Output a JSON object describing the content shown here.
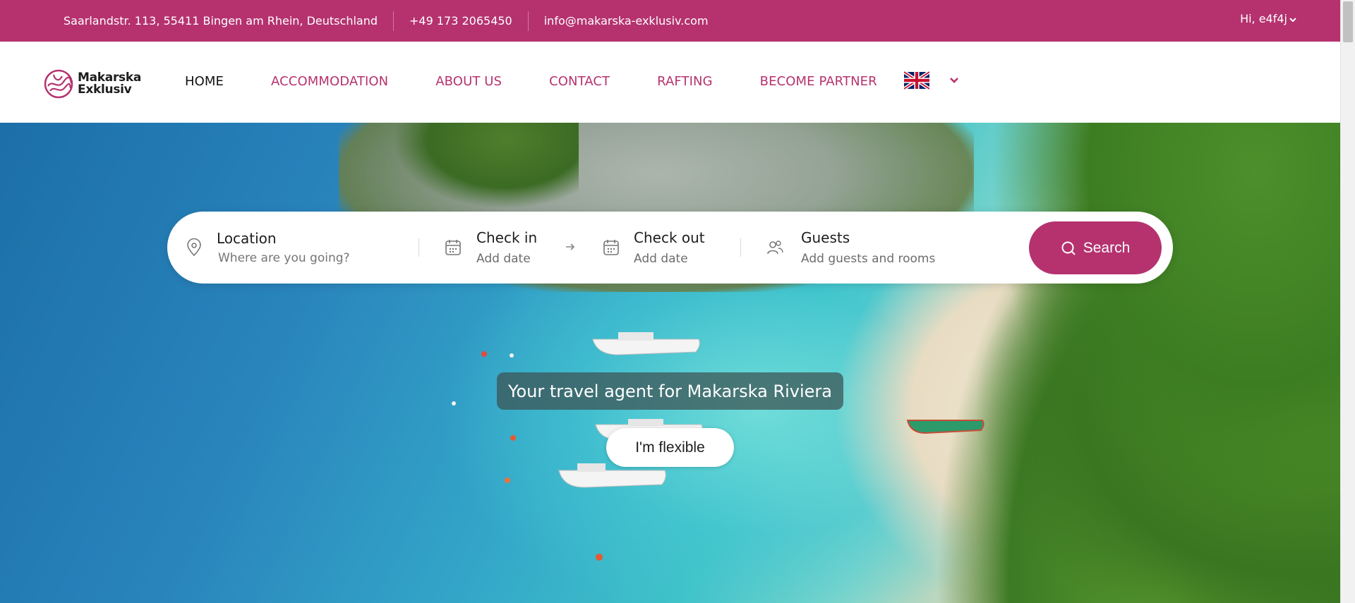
{
  "topbar": {
    "address": "Saarlandstr. 113, 55411 Bingen am Rhein, Deutschland",
    "phone": "+49 173 2065450",
    "email": "info@makarska-exklusiv.com",
    "user_greeting": "Hi, e4f4j"
  },
  "brand": {
    "line1": "Makarska",
    "line2": "Exklusiv",
    "color": "#b5326f"
  },
  "nav": {
    "items": [
      {
        "label": "HOME",
        "active": true
      },
      {
        "label": "ACCOMMODATION",
        "active": false
      },
      {
        "label": "ABOUT US",
        "active": false
      },
      {
        "label": "CONTACT",
        "active": false
      },
      {
        "label": "RAFTING",
        "active": false
      },
      {
        "label": "BECOME PARTNER",
        "active": false
      }
    ],
    "language_icon": "uk-flag-icon"
  },
  "search": {
    "location": {
      "label": "Location",
      "placeholder": "Where are you going?"
    },
    "checkin": {
      "label": "Check in",
      "value": "Add date"
    },
    "checkout": {
      "label": "Check out",
      "value": "Add date"
    },
    "guests": {
      "label": "Guests",
      "value": "Add guests and rooms"
    },
    "button": "Search"
  },
  "hero": {
    "tagline": "Your travel agent for Makarska Riviera",
    "flexible_button": "I'm flexible"
  }
}
